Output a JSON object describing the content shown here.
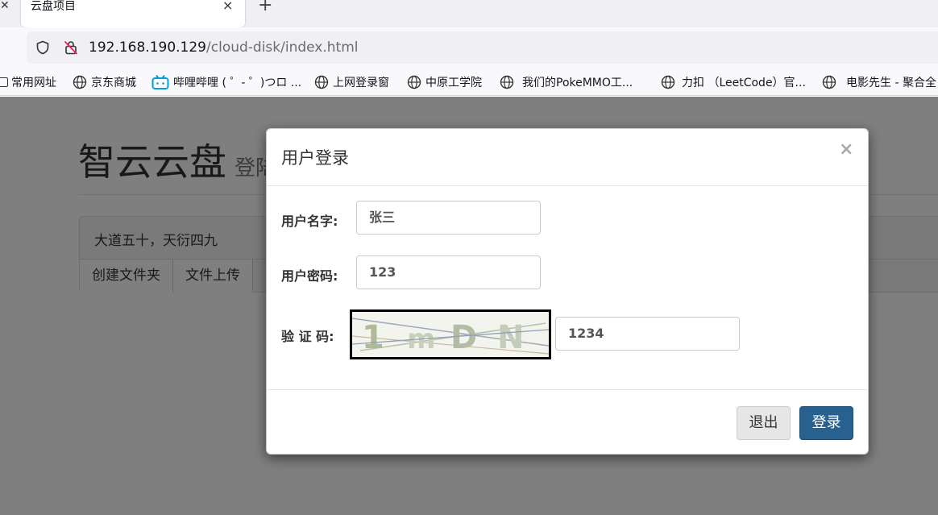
{
  "browser": {
    "tab_title": "云盘项目",
    "tab_close": "×",
    "new_tab": "+",
    "url_host": "192.168.190.129",
    "url_path": "/cloud-disk/index.html",
    "bookmarks": [
      {
        "label": "常用网址",
        "icon": "folder-icon"
      },
      {
        "label": "京东商城",
        "icon": "globe-icon"
      },
      {
        "label": "哔哩哔哩 ( ゜- ゜)つロ ...",
        "icon": "bilibili-icon"
      },
      {
        "label": "上网登录窗",
        "icon": "globe-icon"
      },
      {
        "label": "中原工学院",
        "icon": "globe-icon"
      },
      {
        "label": "我们的PokeMMO工...",
        "icon": "globe-icon"
      },
      {
        "label": "力扣 （LeetCode）官...",
        "icon": "globe-icon"
      },
      {
        "label": "电影先生 - 聚合全",
        "icon": "globe-icon"
      }
    ]
  },
  "page": {
    "site_title": "智云云盘",
    "site_subtitle": "登陆",
    "panel_heading": "大道五十，天衍四九",
    "buttons": [
      "创建文件夹",
      "文件上传"
    ]
  },
  "modal": {
    "title": "用户登录",
    "close": "×",
    "username_label": "用户名字:",
    "username_value": "张三",
    "password_label": "用户密码:",
    "password_value": "123",
    "captcha_label": "验 证 码:",
    "captcha_text": "1mDN",
    "captcha_value": "1234",
    "exit_label": "退出",
    "login_label": "登录"
  },
  "colors": {
    "primary": "#286090",
    "backdrop": "rgba(0,0,0,0.5)",
    "bilibili": "#00a1d6"
  }
}
